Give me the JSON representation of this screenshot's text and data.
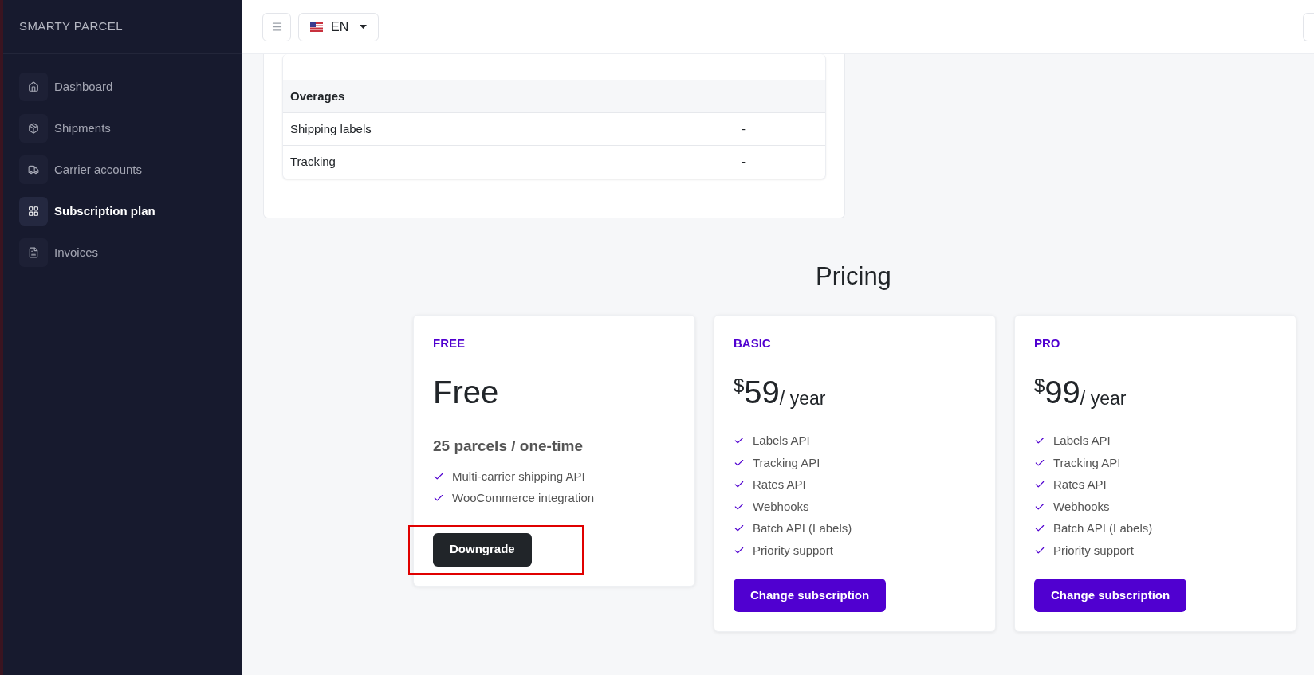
{
  "sidebar": {
    "brand": "SMARTY PARCEL",
    "items": [
      {
        "label": "Dashboard",
        "selected": false
      },
      {
        "label": "Shipments",
        "selected": false
      },
      {
        "label": "Carrier accounts",
        "selected": false
      },
      {
        "label": "Subscription plan",
        "selected": true
      },
      {
        "label": "Invoices",
        "selected": false
      }
    ]
  },
  "header": {
    "language": "EN"
  },
  "usage_table": {
    "rows": [
      {
        "kind": "section",
        "label": "Overages"
      },
      {
        "kind": "item",
        "label": "Shipping labels",
        "value": "-"
      },
      {
        "kind": "item",
        "label": "Tracking",
        "value": "-"
      }
    ]
  },
  "pricing": {
    "title": "Pricing",
    "plans": [
      {
        "name": "FREE",
        "price": {
          "kind": "text",
          "amount": "Free"
        },
        "subtitle": "25 parcels / one-time",
        "features": [
          "Multi-carrier shipping API",
          "WooCommerce integration"
        ],
        "button": {
          "label": "Downgrade",
          "kind": "dark",
          "highlighted": true
        }
      },
      {
        "name": "BASIC",
        "price": {
          "kind": "money",
          "currency": "$",
          "amount": "59",
          "period": "/ year"
        },
        "features": [
          "Labels API",
          "Tracking API",
          "Rates API",
          "Webhooks",
          "Batch API (Labels)",
          "Priority support"
        ],
        "button": {
          "label": "Change subscription",
          "kind": "primary",
          "highlighted": false
        }
      },
      {
        "name": "PRO",
        "price": {
          "kind": "money",
          "currency": "$",
          "amount": "99",
          "period": "/ year"
        },
        "features": [
          "Labels API",
          "Tracking API",
          "Rates API",
          "Webhooks",
          "Batch API (Labels)",
          "Priority support"
        ],
        "button": {
          "label": "Change subscription",
          "kind": "primary",
          "highlighted": false
        }
      }
    ]
  }
}
